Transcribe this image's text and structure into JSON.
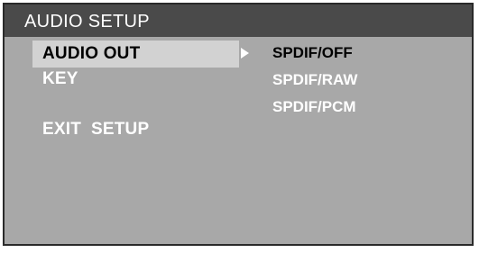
{
  "window": {
    "title": "AUDIO SETUP"
  },
  "menu": {
    "items": [
      {
        "label": "AUDIO OUT",
        "selected": true
      },
      {
        "label": "KEY",
        "selected": false
      },
      {
        "label": "EXIT  SETUP",
        "selected": false
      }
    ]
  },
  "submenu": {
    "arrow_icon": "triangle-right-icon",
    "options": [
      {
        "label": "SPDIF/OFF",
        "active": true
      },
      {
        "label": "SPDIF/RAW",
        "active": false
      },
      {
        "label": "SPDIF/PCM",
        "active": false
      }
    ]
  },
  "colors": {
    "background": "#a8a8a8",
    "title_bar": "#4a4a4a",
    "highlight": "#d2d2d2",
    "text": "#ffffff",
    "selected_text": "#000000"
  }
}
